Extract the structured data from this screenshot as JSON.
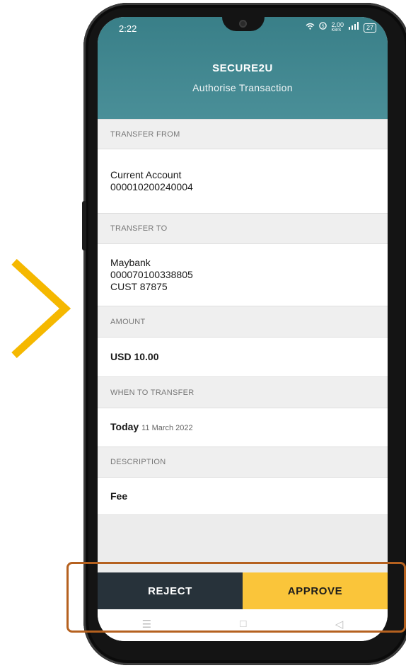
{
  "colors": {
    "header_bg": "#397f88",
    "approve_bg": "#fac53a",
    "reject_bg": "#27323a",
    "chevron": "#f5b800",
    "highlight": "#b5611f"
  },
  "status_bar": {
    "time": "2:22",
    "data_speed": "2.00",
    "data_unit": "KB/S",
    "battery": "27"
  },
  "header": {
    "title": "SECURE2U",
    "subtitle": "Authorise Transaction"
  },
  "fields": {
    "transfer_from": {
      "label": "TRANSFER FROM",
      "account_name": "Current Account",
      "account_number": "000010200240004"
    },
    "transfer_to": {
      "label": "TRANSFER TO",
      "bank": "Maybank",
      "account_number": "000070100338805",
      "reference": "CUST 87875"
    },
    "amount": {
      "label": "AMOUNT",
      "value": "USD 10.00"
    },
    "when": {
      "label": "WHEN TO TRANSFER",
      "day": "Today",
      "date": "11 March 2022"
    },
    "description": {
      "label": "DESCRIPTION",
      "value": "Fee"
    }
  },
  "actions": {
    "reject": "REJECT",
    "approve": "APPROVE"
  },
  "navbar": {
    "menu_glyph": "☰",
    "home_glyph": "□",
    "back_glyph": "◁"
  },
  "icons": [
    "chevron-right-icon",
    "camera-icon",
    "wifi-icon",
    "signal-icon",
    "battery-icon",
    "menu-icon",
    "home-icon",
    "back-icon"
  ]
}
